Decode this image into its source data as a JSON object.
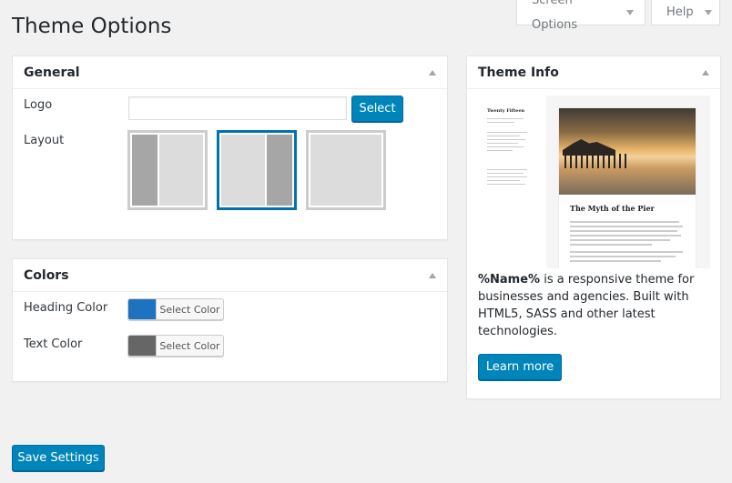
{
  "header": {
    "screen_options_label": "Screen Options",
    "help_label": "Help",
    "page_title": "Theme Options"
  },
  "general": {
    "title": "General",
    "logo_label": "Logo",
    "logo_value": "",
    "logo_placeholder": "",
    "select_button": "Select",
    "layout_label": "Layout",
    "layout_options": [
      "left-sidebar",
      "right-sidebar",
      "no-sidebar"
    ],
    "selected_layout": "right-sidebar"
  },
  "colors": {
    "title": "Colors",
    "heading_label": "Heading Color",
    "heading_color": "#1e73be",
    "text_label": "Text Color",
    "text_color": "#666666",
    "select_color_label": "Select Color"
  },
  "theme_info": {
    "title": "Theme Info",
    "preview": {
      "site_title": "Twenty Fifteen",
      "post_title": "The Myth of the Pier"
    },
    "name_token": "%Name%",
    "description": " is a responsive theme for businesses and agencies. Built with HTML5, SASS and other latest technologies.",
    "learn_more_label": "Learn more"
  },
  "footer": {
    "save_label": "Save Settings"
  },
  "accent_color": "#0085ba"
}
